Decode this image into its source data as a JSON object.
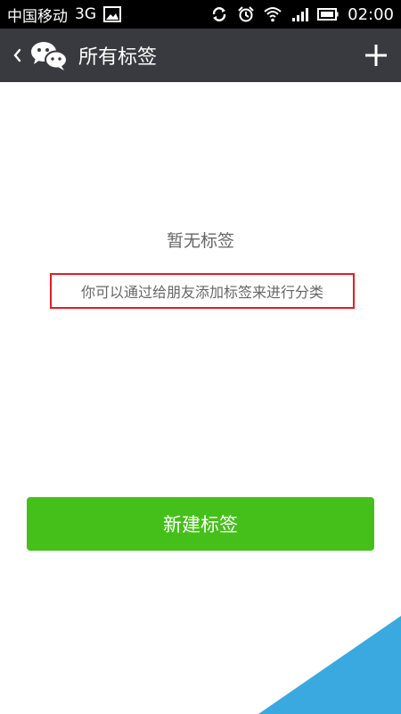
{
  "status_bar": {
    "carrier": "中国移动",
    "network": "3G",
    "time": "02:00",
    "icons": [
      "image-icon",
      "sync-icon",
      "alarm-icon",
      "wifi-icon",
      "signal-icon",
      "battery-icon"
    ]
  },
  "app_bar": {
    "title": "所有标签",
    "icons": [
      "back-icon",
      "wechat-logo-icon",
      "plus-icon"
    ]
  },
  "empty_state": {
    "title": "暂无标签",
    "hint": "你可以通过给朋友添加标签来进行分类"
  },
  "actions": {
    "new_tag_label": "新建标签"
  },
  "colors": {
    "status_bar": "#000000",
    "app_bar": "#393a3f",
    "accent": "#45c01a",
    "highlight_box": "#e21d24",
    "corner": "#3aa9e0"
  }
}
